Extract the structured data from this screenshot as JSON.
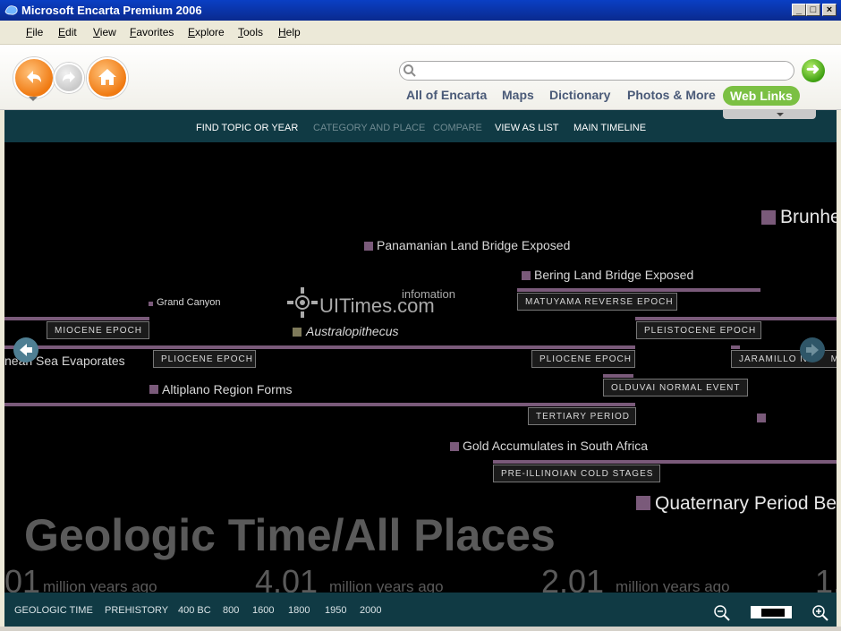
{
  "window": {
    "title": "Microsoft Encarta Premium 2006"
  },
  "menu": [
    {
      "acc": "F",
      "rest": "ile"
    },
    {
      "acc": "E",
      "rest": "dit"
    },
    {
      "acc": "V",
      "rest": "iew"
    },
    {
      "acc": "F",
      "rest": "avorites"
    },
    {
      "acc": "E",
      "rest": "xplore"
    },
    {
      "acc": "T",
      "rest": "ools"
    },
    {
      "acc": "H",
      "rest": "elp"
    }
  ],
  "search": {
    "placeholder": "",
    "value": ""
  },
  "tabs": [
    "All of Encarta",
    "Maps",
    "Dictionary",
    "Photos & More",
    "Web Links"
  ],
  "subnav": [
    "FIND TOPIC OR YEAR",
    "CATEGORY AND PLACE",
    "COMPARE",
    "VIEW AS LIST",
    "MAIN TIMELINE"
  ],
  "timeline": {
    "title": "Geologic Time/All Places",
    "events": [
      "Brunhe",
      "Panamanian Land Bridge Exposed",
      "Bering Land Bridge Exposed",
      "Grand Canyon",
      "Australopithecus",
      "nean Sea Evaporates",
      "Altiplano Region Forms",
      "Gold Accumulates in South Africa",
      "Quaternary Period Be"
    ],
    "periods": [
      "MATUYAMA REVERSE EPOCH",
      "MIOCENE EPOCH",
      "PLEISTOCENE EPOCH",
      "PLIOCENE EPOCH",
      "PLIOCENE EPOCH",
      "JARAMILLO N",
      "MA",
      "OLDUVAI NORMAL EVENT",
      "TERTIARY PERIOD",
      "PRE-ILLINOIAN COLD STAGES"
    ],
    "ruler": [
      {
        "num": "01",
        "unit": "million years ago"
      },
      {
        "num": "4.01",
        "unit": "million years ago"
      },
      {
        "num": "2.01",
        "unit": "million years ago"
      },
      {
        "num": "1.",
        "unit": ""
      }
    ]
  },
  "watermark": {
    "text": "UITimes.com",
    "sub": "infomation"
  },
  "eras": [
    "GEOLOGIC TIME",
    "PREHISTORY",
    "400 BC",
    "800",
    "1600",
    "1800",
    "1950",
    "2000"
  ],
  "colors": {
    "titlebar": "#0a3fc4",
    "teal": "#103a44",
    "event": "#7a5a7a",
    "web_links": "#7bc043"
  }
}
